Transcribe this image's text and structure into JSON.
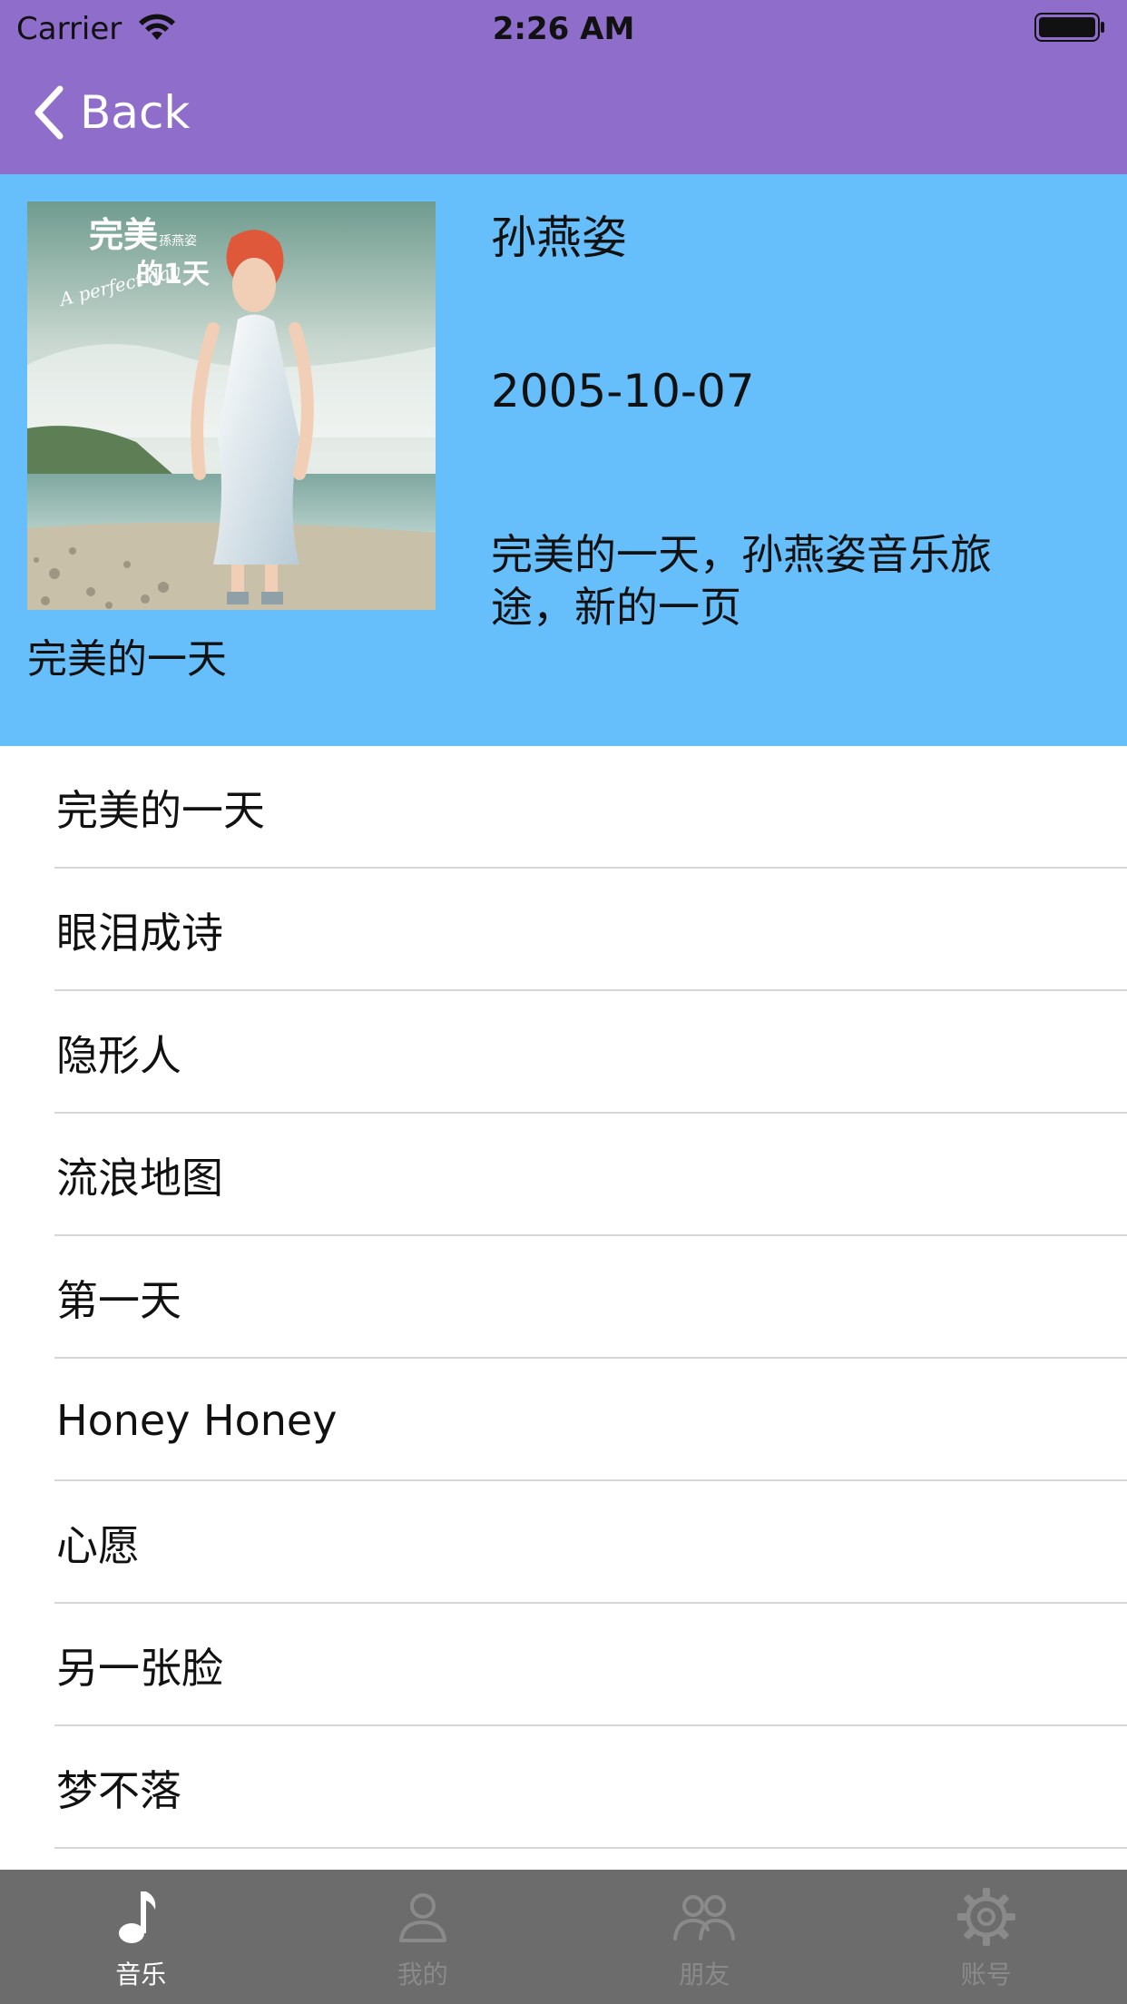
{
  "status_bar": {
    "carrier": "Carrier",
    "time": "2:26 AM"
  },
  "nav": {
    "back_label": "Back"
  },
  "album": {
    "title": "完美的一天",
    "artist": "孙燕姿",
    "release_date": "2005-10-07",
    "description": "完美的一天，孙燕姿音乐旅途，新的一页",
    "cover_text": {
      "title_top": "完美",
      "title_bottom": "的1天",
      "artist": "孫燕姿",
      "script": "A perfect day"
    }
  },
  "tracks": [
    {
      "title": "完美的一天"
    },
    {
      "title": "眼泪成诗"
    },
    {
      "title": "隐形人"
    },
    {
      "title": "流浪地图"
    },
    {
      "title": "第一天"
    },
    {
      "title": "Honey Honey"
    },
    {
      "title": "心愿"
    },
    {
      "title": "另一张脸"
    },
    {
      "title": "梦不落"
    }
  ],
  "tabbar": {
    "items": [
      {
        "label": "音乐",
        "icon": "music-note-icon",
        "active": true
      },
      {
        "label": "我的",
        "icon": "person-icon",
        "active": false
      },
      {
        "label": "朋友",
        "icon": "people-icon",
        "active": false
      },
      {
        "label": "账号",
        "icon": "gear-icon",
        "active": false
      }
    ]
  },
  "colors": {
    "nav_background": "#8e6dcb",
    "album_background": "#66bffb",
    "tabbar_background": "#6c6c6c",
    "tab_active": "#ffffff",
    "tab_inactive": "#8a8a8a"
  }
}
